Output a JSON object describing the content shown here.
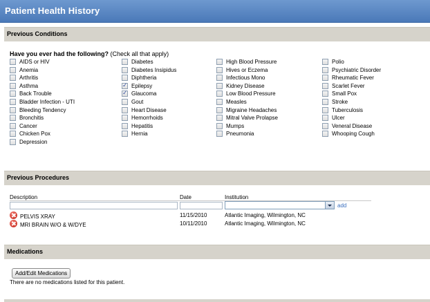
{
  "title": "Patient Health History",
  "conditions": {
    "header": "Previous Conditions",
    "question_bold": "Have you ever had the following?",
    "question_note": "(Check all that apply)",
    "columns": [
      [
        {
          "label": "AIDS or HIV",
          "checked": false
        },
        {
          "label": "Anemia",
          "checked": false
        },
        {
          "label": "Arthritis",
          "checked": false
        },
        {
          "label": "Asthma",
          "checked": false
        },
        {
          "label": "Back Trouble",
          "checked": false
        },
        {
          "label": "Bladder Infection - UTI",
          "checked": false
        },
        {
          "label": "Bleeding Tendency",
          "checked": false
        },
        {
          "label": "Bronchitis",
          "checked": false
        },
        {
          "label": "Cancer",
          "checked": false
        },
        {
          "label": "Chicken Pox",
          "checked": false
        },
        {
          "label": "Depression",
          "checked": false
        }
      ],
      [
        {
          "label": "Diabetes",
          "checked": false
        },
        {
          "label": "Diabetes Insipidus",
          "checked": false
        },
        {
          "label": "Diphtheria",
          "checked": false
        },
        {
          "label": "Epilepsy",
          "checked": true
        },
        {
          "label": "Glaucoma",
          "checked": true
        },
        {
          "label": "Gout",
          "checked": false
        },
        {
          "label": "Heart Disease",
          "checked": false
        },
        {
          "label": "Hemorrhoids",
          "checked": false
        },
        {
          "label": "Hepatitis",
          "checked": false
        },
        {
          "label": "Hernia",
          "checked": false
        }
      ],
      [
        {
          "label": "High Blood Pressure",
          "checked": false
        },
        {
          "label": "Hives or Eczema",
          "checked": false
        },
        {
          "label": "Infectious Mono",
          "checked": false
        },
        {
          "label": "Kidney Disease",
          "checked": false
        },
        {
          "label": "Low Blood Pressure",
          "checked": false
        },
        {
          "label": "Measles",
          "checked": false
        },
        {
          "label": "Migraine Headaches",
          "checked": false
        },
        {
          "label": "Mitral Valve Prolapse",
          "checked": false
        },
        {
          "label": "Mumps",
          "checked": false
        },
        {
          "label": "Pneumonia",
          "checked": false
        }
      ],
      [
        {
          "label": "Polio",
          "checked": false
        },
        {
          "label": "Psychiatric Disorder",
          "checked": false
        },
        {
          "label": "Rheumatic Fever",
          "checked": false
        },
        {
          "label": "Scarlet Fever",
          "checked": false
        },
        {
          "label": "Small Pox",
          "checked": false
        },
        {
          "label": "Stroke",
          "checked": false
        },
        {
          "label": "Tuberculosis",
          "checked": false
        },
        {
          "label": "Ulcer",
          "checked": false
        },
        {
          "label": "Veneral Disease",
          "checked": false
        },
        {
          "label": "Whooping Cough",
          "checked": false
        }
      ]
    ]
  },
  "procedures": {
    "header": "Previous Procedures",
    "col_description": "Description",
    "col_date": "Date",
    "col_institution": "Institution",
    "add_label": "add",
    "rows": [
      {
        "description": "PELVIS XRAY",
        "date": "11/15/2010",
        "institution": "Atlantic Imaging, Wilmington, NC"
      },
      {
        "description": "MRI BRAIN W/O & W/DYE",
        "date": "10/11/2010",
        "institution": "Atlantic Imaging, Wilmington, NC"
      }
    ]
  },
  "medications": {
    "header": "Medications",
    "button_label": "Add/Edit Medications",
    "empty_text": "There are no medications listed for this patient."
  }
}
